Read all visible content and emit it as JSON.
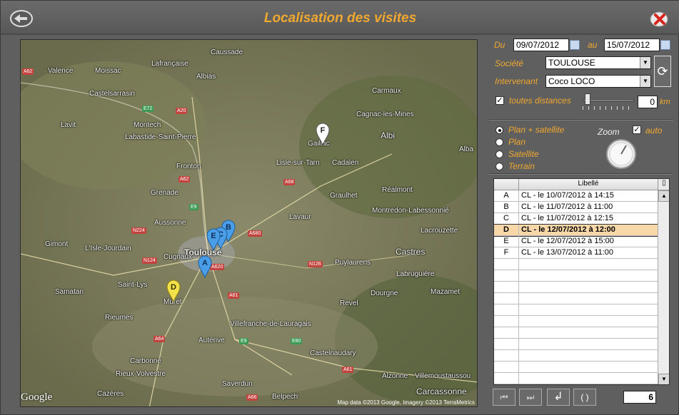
{
  "window": {
    "title": "Localisation des visites"
  },
  "filters": {
    "du_label": "Du",
    "du_value": "09/07/2012",
    "au_label": "au",
    "au_value": "15/07/2012",
    "societe_label": "Société",
    "societe_value": "TOULOUSE",
    "intervenant_label": "Intervenant",
    "intervenant_value": "Coco LOCO",
    "distances_label": "toutes distances",
    "distance_value": "0",
    "distance_unit": "km"
  },
  "view_mode": {
    "options": [
      "Plan + satellite",
      "Plan",
      "Satellite",
      "Terrain"
    ],
    "selected": "Plan + satellite",
    "zoom_label": "Zoom",
    "auto_label": "auto"
  },
  "table": {
    "header": "Libellé",
    "rows": [
      {
        "key": "A",
        "label": "CL -  le 10/07/2012 à 14:15"
      },
      {
        "key": "B",
        "label": "CL -  le 11/07/2012 à 11:00"
      },
      {
        "key": "C",
        "label": "CL -  le 11/07/2012 à 12:15"
      },
      {
        "key": "D",
        "label": "CL -   le 12/07/2012 à 12:00"
      },
      {
        "key": "E",
        "label": "CL -  le 12/07/2012 à 15:00"
      },
      {
        "key": "F",
        "label": "CL -  le 13/07/2012 à 11:00"
      }
    ],
    "selected_row": "D",
    "count": "6"
  },
  "map": {
    "places": [
      "Caussade",
      "Valence",
      "Moissac",
      "Lafrançaise",
      "Albias",
      "Carmaux",
      "Castelsarrasin",
      "Cagnac-les-Mines",
      "Lavit",
      "Montech",
      "Albi",
      "Labastide-Saint-Pierre",
      "Gaillac",
      "Alba",
      "Lisle-sur-Tarn",
      "Cadalen",
      "Fronton",
      "Grenade",
      "Graulhet",
      "Réalmont",
      "Aussonne",
      "Lavaur",
      "Montredon-Labessonnié",
      "Gimont",
      "L'Isle-Jourdain",
      "Toulouse",
      "Lacrouzette",
      "Castres",
      "Puylaurens",
      "Cugnaux",
      "Samatan",
      "Saint-Lys",
      "Labruguière",
      "Muret",
      "Dourgne",
      "Mazamet",
      "Revel",
      "Rieumes",
      "Villefranche-de-Lauragais",
      "Autérive",
      "Castelnaudary",
      "Carbonne",
      "Rieux-Volvestre",
      "Saverdun",
      "Alzonne",
      "Villemoustaussou",
      "Cazères",
      "Belpech",
      "Carcassonne"
    ],
    "roads": [
      "A62",
      "E72",
      "A20",
      "A68",
      "A62",
      "E9",
      "N224",
      "N124",
      "A680",
      "N126",
      "A620",
      "A61",
      "E9",
      "E80",
      "A64",
      "A61",
      "A66"
    ],
    "markers": [
      "A",
      "B",
      "C",
      "D",
      "E",
      "F"
    ],
    "logo": "Google",
    "attribution": "Map data ©2013 Google, Imagery ©2013 TerraMetrics"
  },
  "colors": {
    "accent": "#f0a830",
    "background": "#5f5f5f",
    "selected_row": "#f8d7a8"
  }
}
